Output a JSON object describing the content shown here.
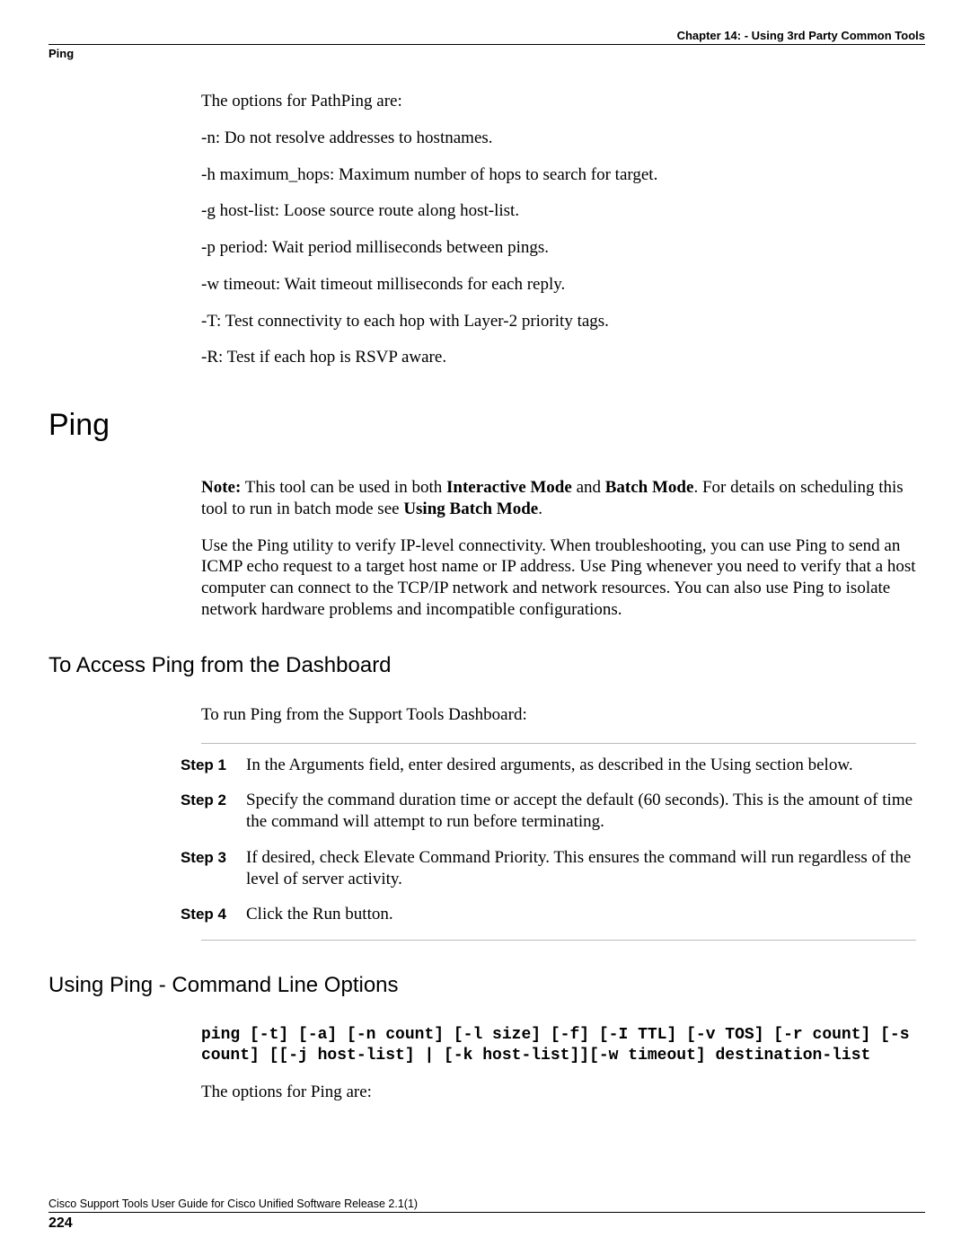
{
  "header": {
    "chapter": "Chapter 14: - Using 3rd Party Common Tools",
    "section": "Ping"
  },
  "pathping": {
    "intro": "The options for PathPing are:",
    "opts": [
      "-n: Do not resolve addresses to hostnames.",
      "-h maximum_hops: Maximum number of hops to search for target.",
      "-g host-list: Loose source route along host-list.",
      "-p period: Wait period milliseconds between pings.",
      "-w timeout: Wait timeout milliseconds for each reply.",
      "-T: Test connectivity to each hop with Layer-2 priority tags.",
      "-R: Test if each hop is RSVP aware."
    ]
  },
  "ping": {
    "heading": "Ping",
    "note_prefix": "Note:",
    "note_mid1": " This tool can be used in both ",
    "note_bold1": "Interactive Mode",
    "note_mid2": " and ",
    "note_bold2": "Batch Mode",
    "note_mid3": ". For details on scheduling this tool to run in batch mode see ",
    "note_bold3": "Using Batch Mode",
    "note_end": ".",
    "desc": "Use the Ping utility to verify IP-level connectivity. When troubleshooting, you can use Ping to send an ICMP echo request to a target host name or IP address. Use Ping whenever you need to verify that a host computer can connect to the TCP/IP network and network resources. You can also use Ping to isolate network hardware problems and incompatible configurations."
  },
  "access": {
    "heading": "To Access Ping from the Dashboard",
    "intro": "To run Ping from the Support Tools Dashboard:",
    "steps": [
      {
        "label": "Step 1",
        "text": "In the Arguments field, enter desired arguments, as described in the Using section below."
      },
      {
        "label": "Step 2",
        "text": "Specify the command duration time or accept the default (60 seconds). This is the amount of time the command will attempt to run before terminating."
      },
      {
        "label": "Step 3",
        "text": "If desired, check Elevate Command Priority. This ensures the command will run regardless of the level of server activity."
      },
      {
        "label": "Step 4",
        "text": "Click the Run button."
      }
    ]
  },
  "cli": {
    "heading": "Using Ping - Command Line Options",
    "code": "ping [-t] [-a] [-n count] [-l size] [-f] [-I TTL] [-v TOS] [-r count] [-s count] [[-j host-list] | [-k host-list]][-w timeout] destination-list",
    "outro": "The options for Ping are:"
  },
  "footer": {
    "title": "Cisco Support Tools User Guide for Cisco Unified Software Release 2.1(1)",
    "page": "224"
  }
}
